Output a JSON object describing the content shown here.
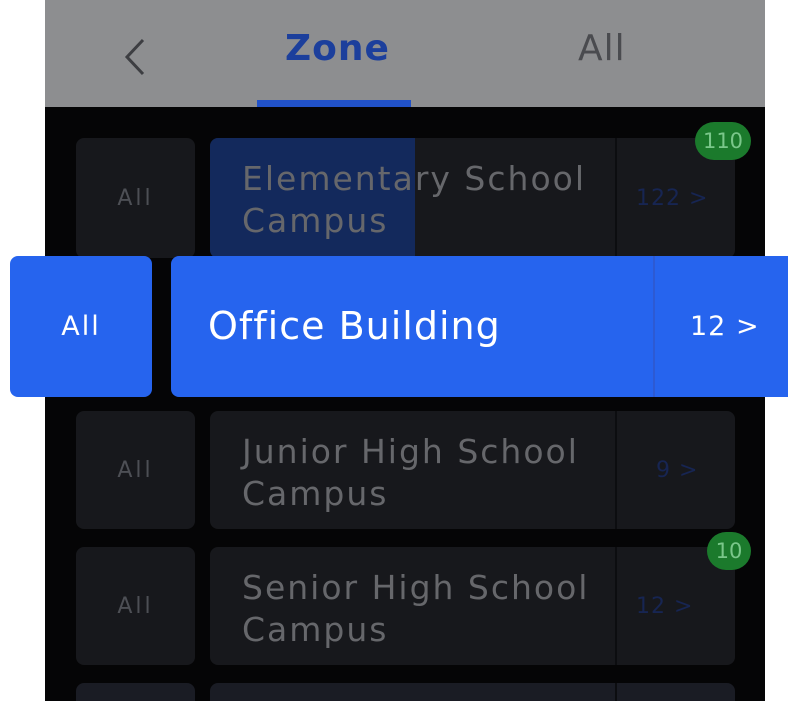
{
  "header": {
    "back_icon": "chevron-left-icon",
    "tabs": [
      {
        "label": "Zone",
        "active": true
      },
      {
        "label": "All",
        "active": false
      }
    ]
  },
  "zones": [
    {
      "all_label": "All",
      "name_line1": "Elementary School",
      "name_line2": "Campus",
      "count": "122 >",
      "badge": "110"
    },
    {
      "all_label": "All",
      "name": "Office Building",
      "count": "12 >",
      "selected": true
    },
    {
      "all_label": "All",
      "name_line1": "Junior High School",
      "name_line2": "Campus",
      "count": "9 >"
    },
    {
      "all_label": "All",
      "name_line1": "Senior High School",
      "name_line2": "Campus",
      "count": "12 >",
      "badge": "10"
    }
  ],
  "colors": {
    "header_bg": "#8d8e90",
    "accent": "#2664ee",
    "badge": "#1b7a2c",
    "background": "#050506"
  }
}
